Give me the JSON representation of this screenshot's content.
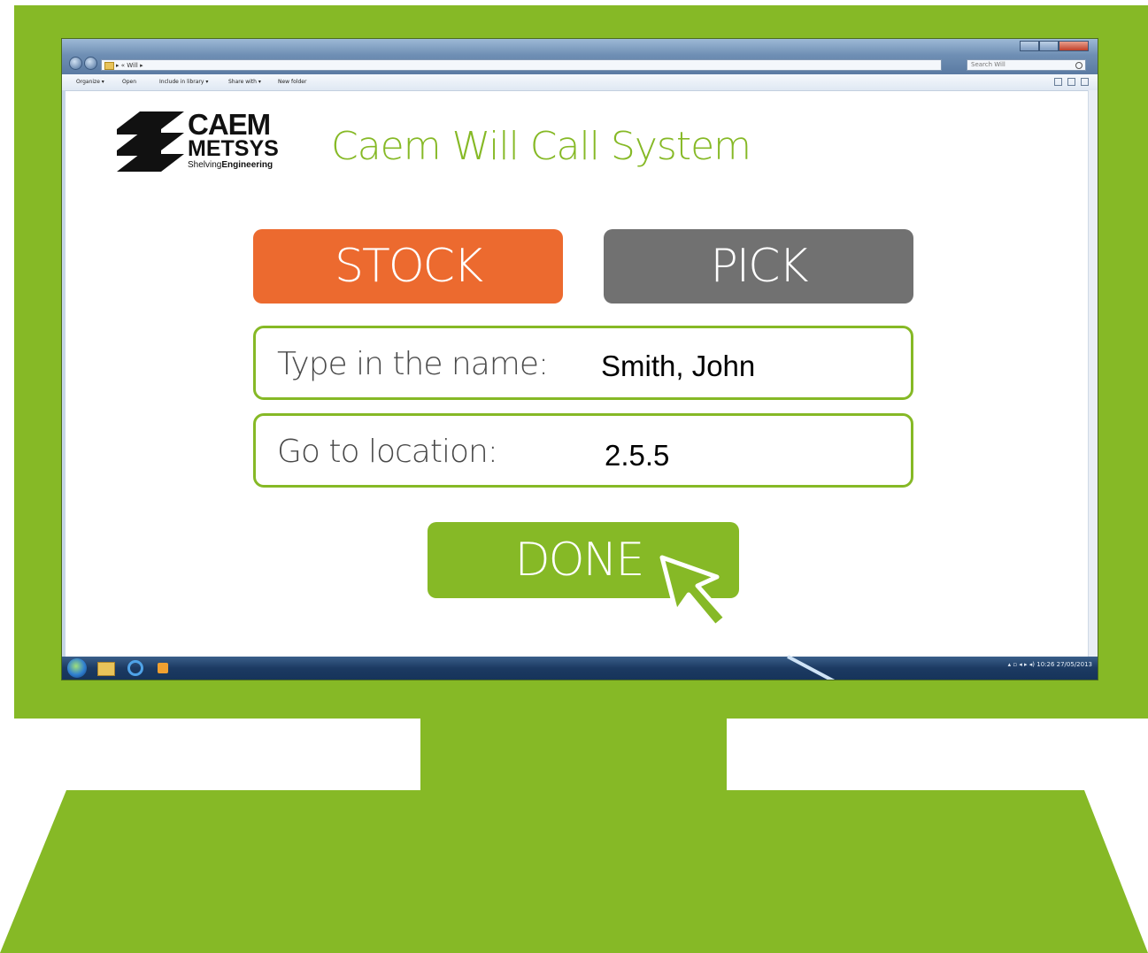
{
  "window": {
    "address_text": "▸ « Will ▸",
    "search_placeholder": "Search Will",
    "toolbar": {
      "organize": "Organize ▾",
      "open": "Open",
      "include_in_library": "Include in library ▾",
      "share_with": "Share with ▾",
      "new_folder": "New folder"
    },
    "tray_text": "▴ ▫ ◂ ▸ ◂)  10:26 27/05/2013"
  },
  "logo": {
    "line1": "CAEM",
    "line2": "METSYS",
    "line3_light": "Shelving",
    "line3_bold": "Engineering"
  },
  "app": {
    "title": "Caem Will Call System",
    "stock_label": "STOCK",
    "pick_label": "PICK",
    "name_label": "Type in the name:",
    "name_value": "Smith, John",
    "location_label": "Go to location:",
    "location_value": "2.5.5",
    "done_label": "DONE"
  },
  "colors": {
    "brand_green": "#86b926",
    "stock_orange": "#ec6a2f",
    "pick_gray": "#717171"
  }
}
